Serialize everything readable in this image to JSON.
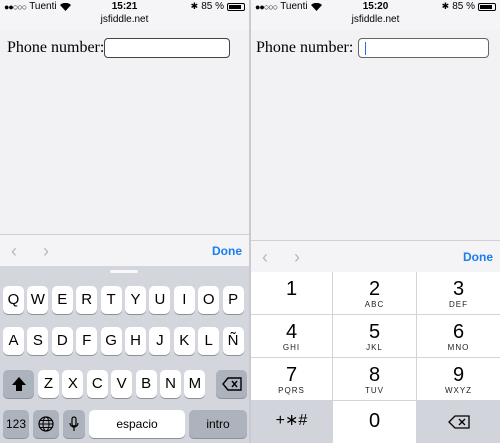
{
  "left_screen": {
    "status": {
      "carrier": "Tuenti",
      "time": "15:21",
      "battery": "85 %"
    },
    "url": "jsfiddle.net",
    "form": {
      "label": "Phone number:",
      "value": ""
    },
    "accessory": {
      "prev_icon": "chevron-left-icon",
      "next_icon": "chevron-right-icon",
      "done": "Done"
    },
    "keyboard": {
      "row1": [
        "Q",
        "W",
        "E",
        "R",
        "T",
        "Y",
        "U",
        "I",
        "O",
        "P"
      ],
      "row2": [
        "A",
        "S",
        "D",
        "F",
        "G",
        "H",
        "J",
        "K",
        "L",
        "Ñ"
      ],
      "row3": [
        "Z",
        "X",
        "C",
        "V",
        "B",
        "N",
        "M"
      ],
      "bottom": {
        "numbers": "123",
        "space": "espacio",
        "return": "intro"
      }
    }
  },
  "right_screen": {
    "status": {
      "carrier": "Tuenti",
      "time": "15:20",
      "battery": "85 %"
    },
    "url": "jsfiddle.net",
    "form": {
      "label": "Phone number:",
      "value": ""
    },
    "accessory": {
      "prev_icon": "chevron-left-icon",
      "next_icon": "chevron-right-icon",
      "done": "Done"
    },
    "keypad": {
      "keys": [
        {
          "digit": "1",
          "letters": ""
        },
        {
          "digit": "2",
          "letters": "ABC"
        },
        {
          "digit": "3",
          "letters": "DEF"
        },
        {
          "digit": "4",
          "letters": "GHI"
        },
        {
          "digit": "5",
          "letters": "JKL"
        },
        {
          "digit": "6",
          "letters": "MNO"
        },
        {
          "digit": "7",
          "letters": "PQRS"
        },
        {
          "digit": "8",
          "letters": "TUV"
        },
        {
          "digit": "9",
          "letters": "WXYZ"
        }
      ],
      "symbols": "+∗#",
      "zero": "0"
    }
  },
  "colors": {
    "done_blue": "#1a7ef2",
    "caret_blue": "#1a6fff",
    "keyboard_bg": "#d3d6dc"
  }
}
